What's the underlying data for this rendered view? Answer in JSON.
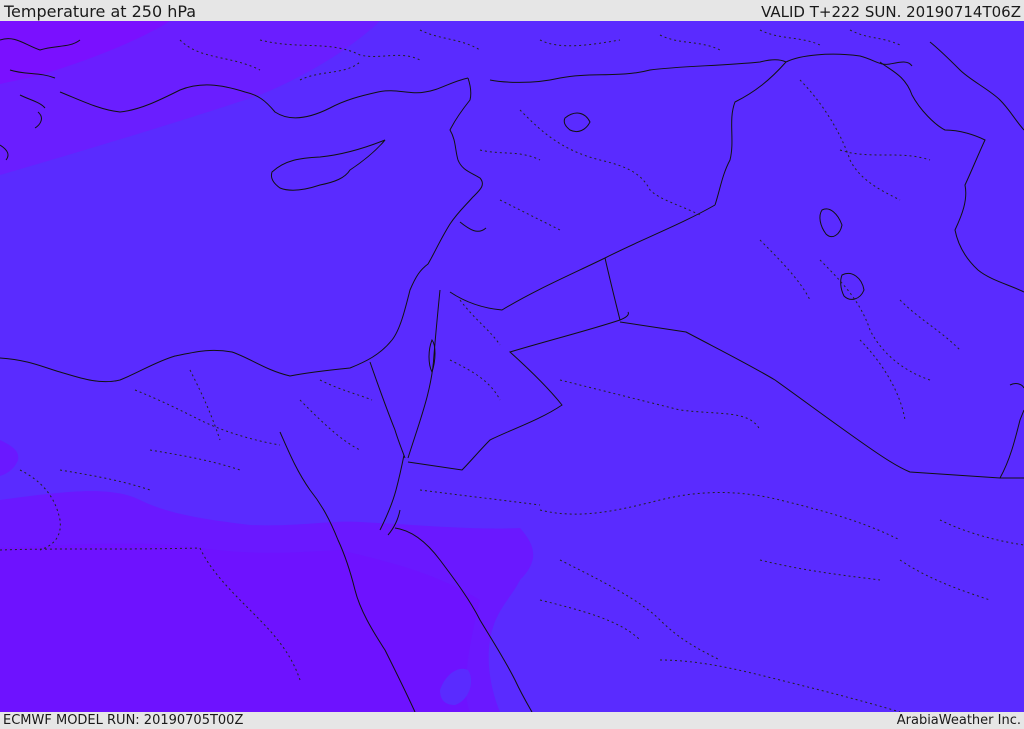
{
  "header": {
    "title": "Temperature at 250 hPa",
    "valid": "VALID T+222 SUN. 20190714T06Z"
  },
  "footer": {
    "model_run": "ECMWF MODEL RUN: 20190705T00Z",
    "credit": "ArabiaWeather Inc."
  },
  "map": {
    "colors": {
      "base_shade": "#5a2bff",
      "warm_shade_north": "#7a10ff",
      "warm_shade_south": "#6a18ff",
      "transition_shade": "#6624ff",
      "coastline": "#111111",
      "border": "#111111",
      "admin_border": "#222222"
    }
  }
}
